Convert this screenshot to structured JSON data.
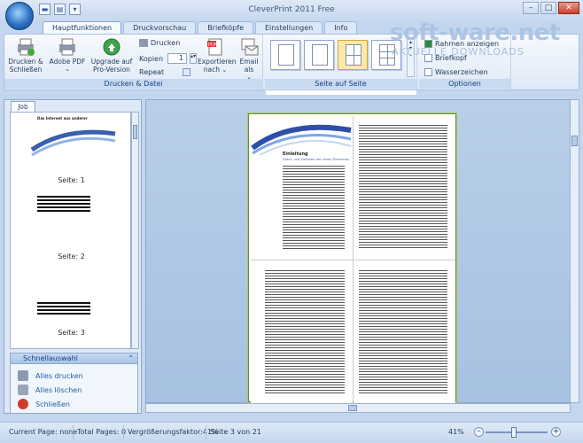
{
  "window": {
    "title": "CleverPrint 2011 Free"
  },
  "tabs": [
    {
      "label": "Hauptfunktionen",
      "active": true
    },
    {
      "label": "Druckvorschau"
    },
    {
      "label": "Briefköpfe"
    },
    {
      "label": "Einstellungen"
    },
    {
      "label": "Info"
    }
  ],
  "ribbon": {
    "print_group": {
      "label": "Drucken & Datei",
      "print_close": "Drucken & Schließen",
      "adobe_pdf": "Adobe PDF",
      "upgrade": "Upgrade auf Pro-Version",
      "print": "Drucken",
      "copies_label": "Kopien",
      "copies_value": "1",
      "repeat_label": "Repeat",
      "export": "Exportieren nach",
      "email": "Email als"
    },
    "pages_group": {
      "label": "Seite auf Seite"
    },
    "options_group": {
      "label": "Optionen",
      "frames": "Rahmen anzeigen",
      "letterhead": "Briefkopf",
      "watermark": "Wasserzeichen"
    }
  },
  "watermark": {
    "brand": "soft-ware.net",
    "tagline": "AKTUELLE DOWNLOADS"
  },
  "left_panel": {
    "job_tab": "Job",
    "thumbnails": [
      "Seite: 1",
      "Seite: 2",
      "Seite: 3"
    ],
    "thumb_heading": "Das Internet aus anderer",
    "quick_title": "Schnellauswahl",
    "quick_items": [
      "Alles drucken",
      "Alles löschen",
      "Schließen"
    ]
  },
  "preview": {
    "heading": "Einleitung",
    "subheading": "Grenz- und Ziellinien der neuen Dimension"
  },
  "status": {
    "current_page": "Current Page: none",
    "total_pages": "Total Pages: 0",
    "zoom_factor": "Vergrößerungsfaktor:41%",
    "page_of": "Seite 3 von 21",
    "zoom": "41%",
    "zoom_level": 0.41
  },
  "colors": {
    "accent": "#1e395b",
    "frame": "#a5c86b"
  }
}
